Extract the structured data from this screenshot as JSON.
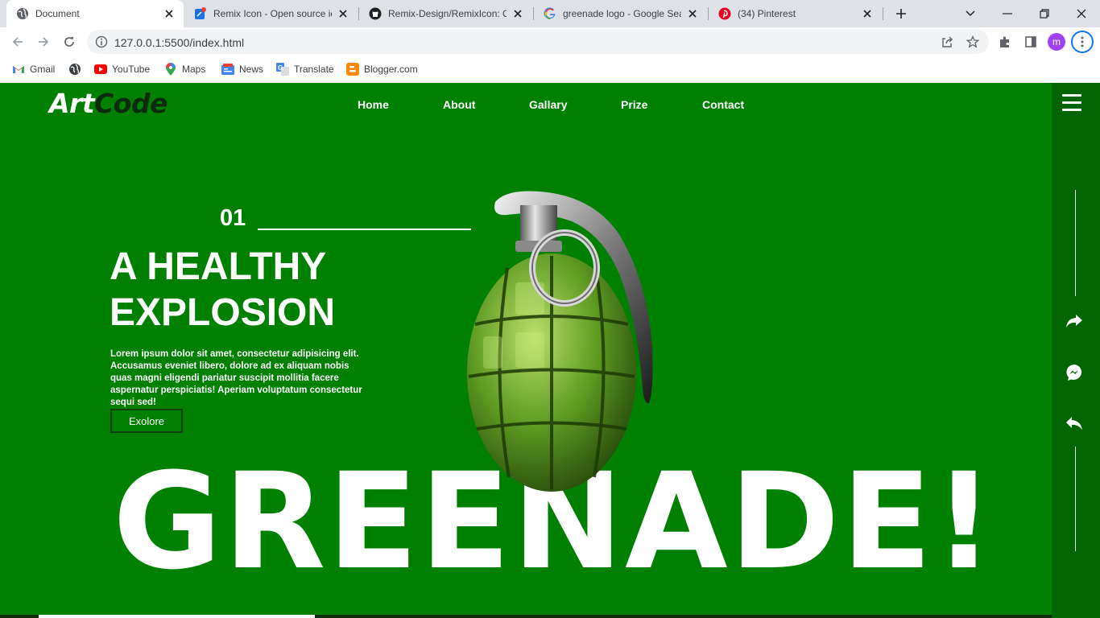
{
  "browser": {
    "tabs": [
      {
        "title": "Document",
        "icon": "globe-icon",
        "active": true
      },
      {
        "title": "Remix Icon - Open source icons",
        "icon": "remix-icon"
      },
      {
        "title": "Remix-Design/RemixIcon: Open",
        "icon": "github-icon"
      },
      {
        "title": "greenade logo - Google Search",
        "icon": "google-icon"
      },
      {
        "title": "(34) Pinterest",
        "icon": "pinterest-icon"
      }
    ],
    "url": "127.0.0.1:5500/index.html",
    "profile_initial": "m",
    "bookmarks": [
      {
        "label": "Gmail",
        "icon": "gmail-icon"
      },
      {
        "label": "",
        "icon": "globe-icon"
      },
      {
        "label": "YouTube",
        "icon": "youtube-icon"
      },
      {
        "label": "Maps",
        "icon": "maps-icon"
      },
      {
        "label": "News",
        "icon": "news-icon"
      },
      {
        "label": "Translate",
        "icon": "translate-icon"
      },
      {
        "label": "Blogger.com",
        "icon": "blogger-icon"
      }
    ]
  },
  "page": {
    "logo": {
      "part1": "Art",
      "part2": "Code"
    },
    "nav": [
      "Home",
      "About",
      "Gallary",
      "Prize",
      "Contact"
    ],
    "slide_number": "01",
    "headline_line1": "A HEALTHY",
    "headline_line2": "EXPLOSION",
    "description": "Lorem ipsum dolor sit amet, consectetur adipisicing elit. Accusamus eveniet libero, dolore ad ex aliquam nobis quas magni eligendi pariatur suscipit mollitia facere aspernatur perspiciatis! Aperiam voluptatum consectetur sequi sed!",
    "explore_label": "Exolore",
    "big_word": "GREENADE!",
    "side_icons": [
      "share-forward-icon",
      "messenger-icon",
      "reply-icon"
    ],
    "colors": {
      "background": "#008000",
      "sidebar": "#006400",
      "text": "#ffffff",
      "logo_dark": "#0e2a0e"
    }
  }
}
